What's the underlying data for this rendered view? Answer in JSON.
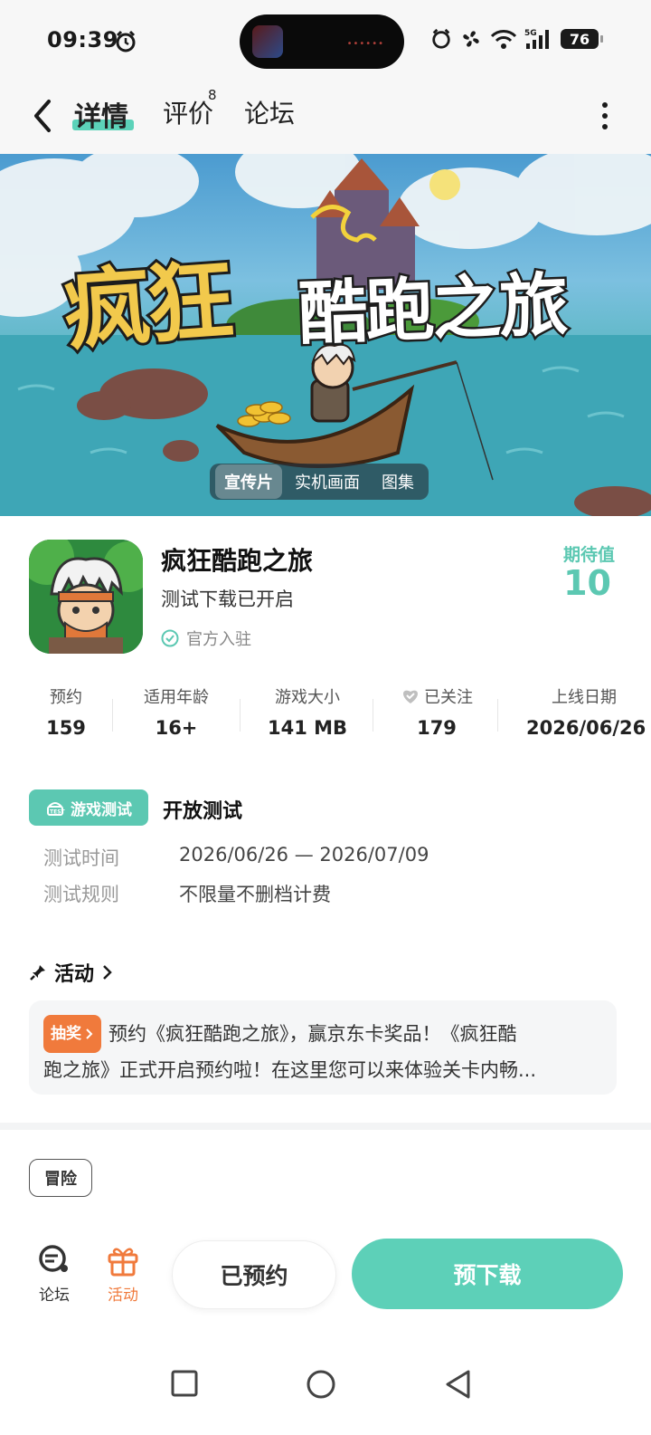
{
  "status_bar": {
    "time": "09:39",
    "battery": "76",
    "network": "5G"
  },
  "nav": {
    "detail": "详情",
    "review": "评价",
    "review_count": "8",
    "forum": "论坛"
  },
  "banner": {
    "title_part1": "疯狂",
    "title_part2": "酷跑之旅",
    "media_tabs": [
      "宣传片",
      "实机画面",
      "图集"
    ]
  },
  "game": {
    "name": "疯狂酷跑之旅",
    "subtitle": "测试下载已开启",
    "official": "官方入驻",
    "expect_label": "期待值",
    "expect_value": "10"
  },
  "stats": [
    {
      "label": "预约",
      "value": "159"
    },
    {
      "label": "适用年龄",
      "value": "16+"
    },
    {
      "label": "游戏大小",
      "value": "141 MB"
    },
    {
      "label": "已关注",
      "value": "179"
    },
    {
      "label": "上线日期",
      "value": "2026/06/26"
    }
  ],
  "test": {
    "badge": "游戏测试",
    "title": "开放测试",
    "rows": [
      {
        "label": "测试时间",
        "value": "2026/06/26 — 2026/07/09"
      },
      {
        "label": "测试规则",
        "value": "不限量不删档计费"
      }
    ]
  },
  "activity": {
    "heading": "活动",
    "tag": "抽奖",
    "line1": "预约《疯狂酷跑之旅》，赢京东卡奖品！《疯狂酷",
    "line2": "跑之旅》正式开启预约啦！在这里您可以来体验关卡内畅..."
  },
  "genre_tag": "冒险",
  "bottom": {
    "forum": "论坛",
    "activity": "活动",
    "reserved": "已预约",
    "pre_download": "预下载"
  },
  "colors": {
    "accent": "#5cc8b2",
    "orange": "#f07a3c"
  }
}
